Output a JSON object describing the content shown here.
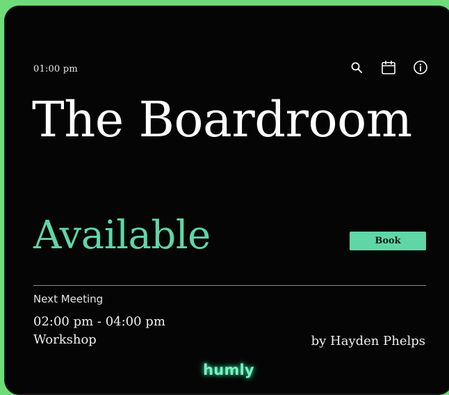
{
  "header": {
    "time": "01:00 pm",
    "icons": [
      "search-icon",
      "calendar-icon",
      "info-icon"
    ]
  },
  "room": {
    "name": "The Boardroom",
    "status": "Available"
  },
  "actions": {
    "book_label": "Book"
  },
  "next_meeting": {
    "label": "Next Meeting",
    "time_range": "02:00 pm - 04:00 pm",
    "type": "Workshop",
    "organizer": "by Hayden Phelps"
  },
  "brand": {
    "name": "humly"
  },
  "colors": {
    "accent": "#5fd6a6",
    "background": "#050505",
    "frame": "#6fdc7a",
    "text": "#ffffff"
  }
}
